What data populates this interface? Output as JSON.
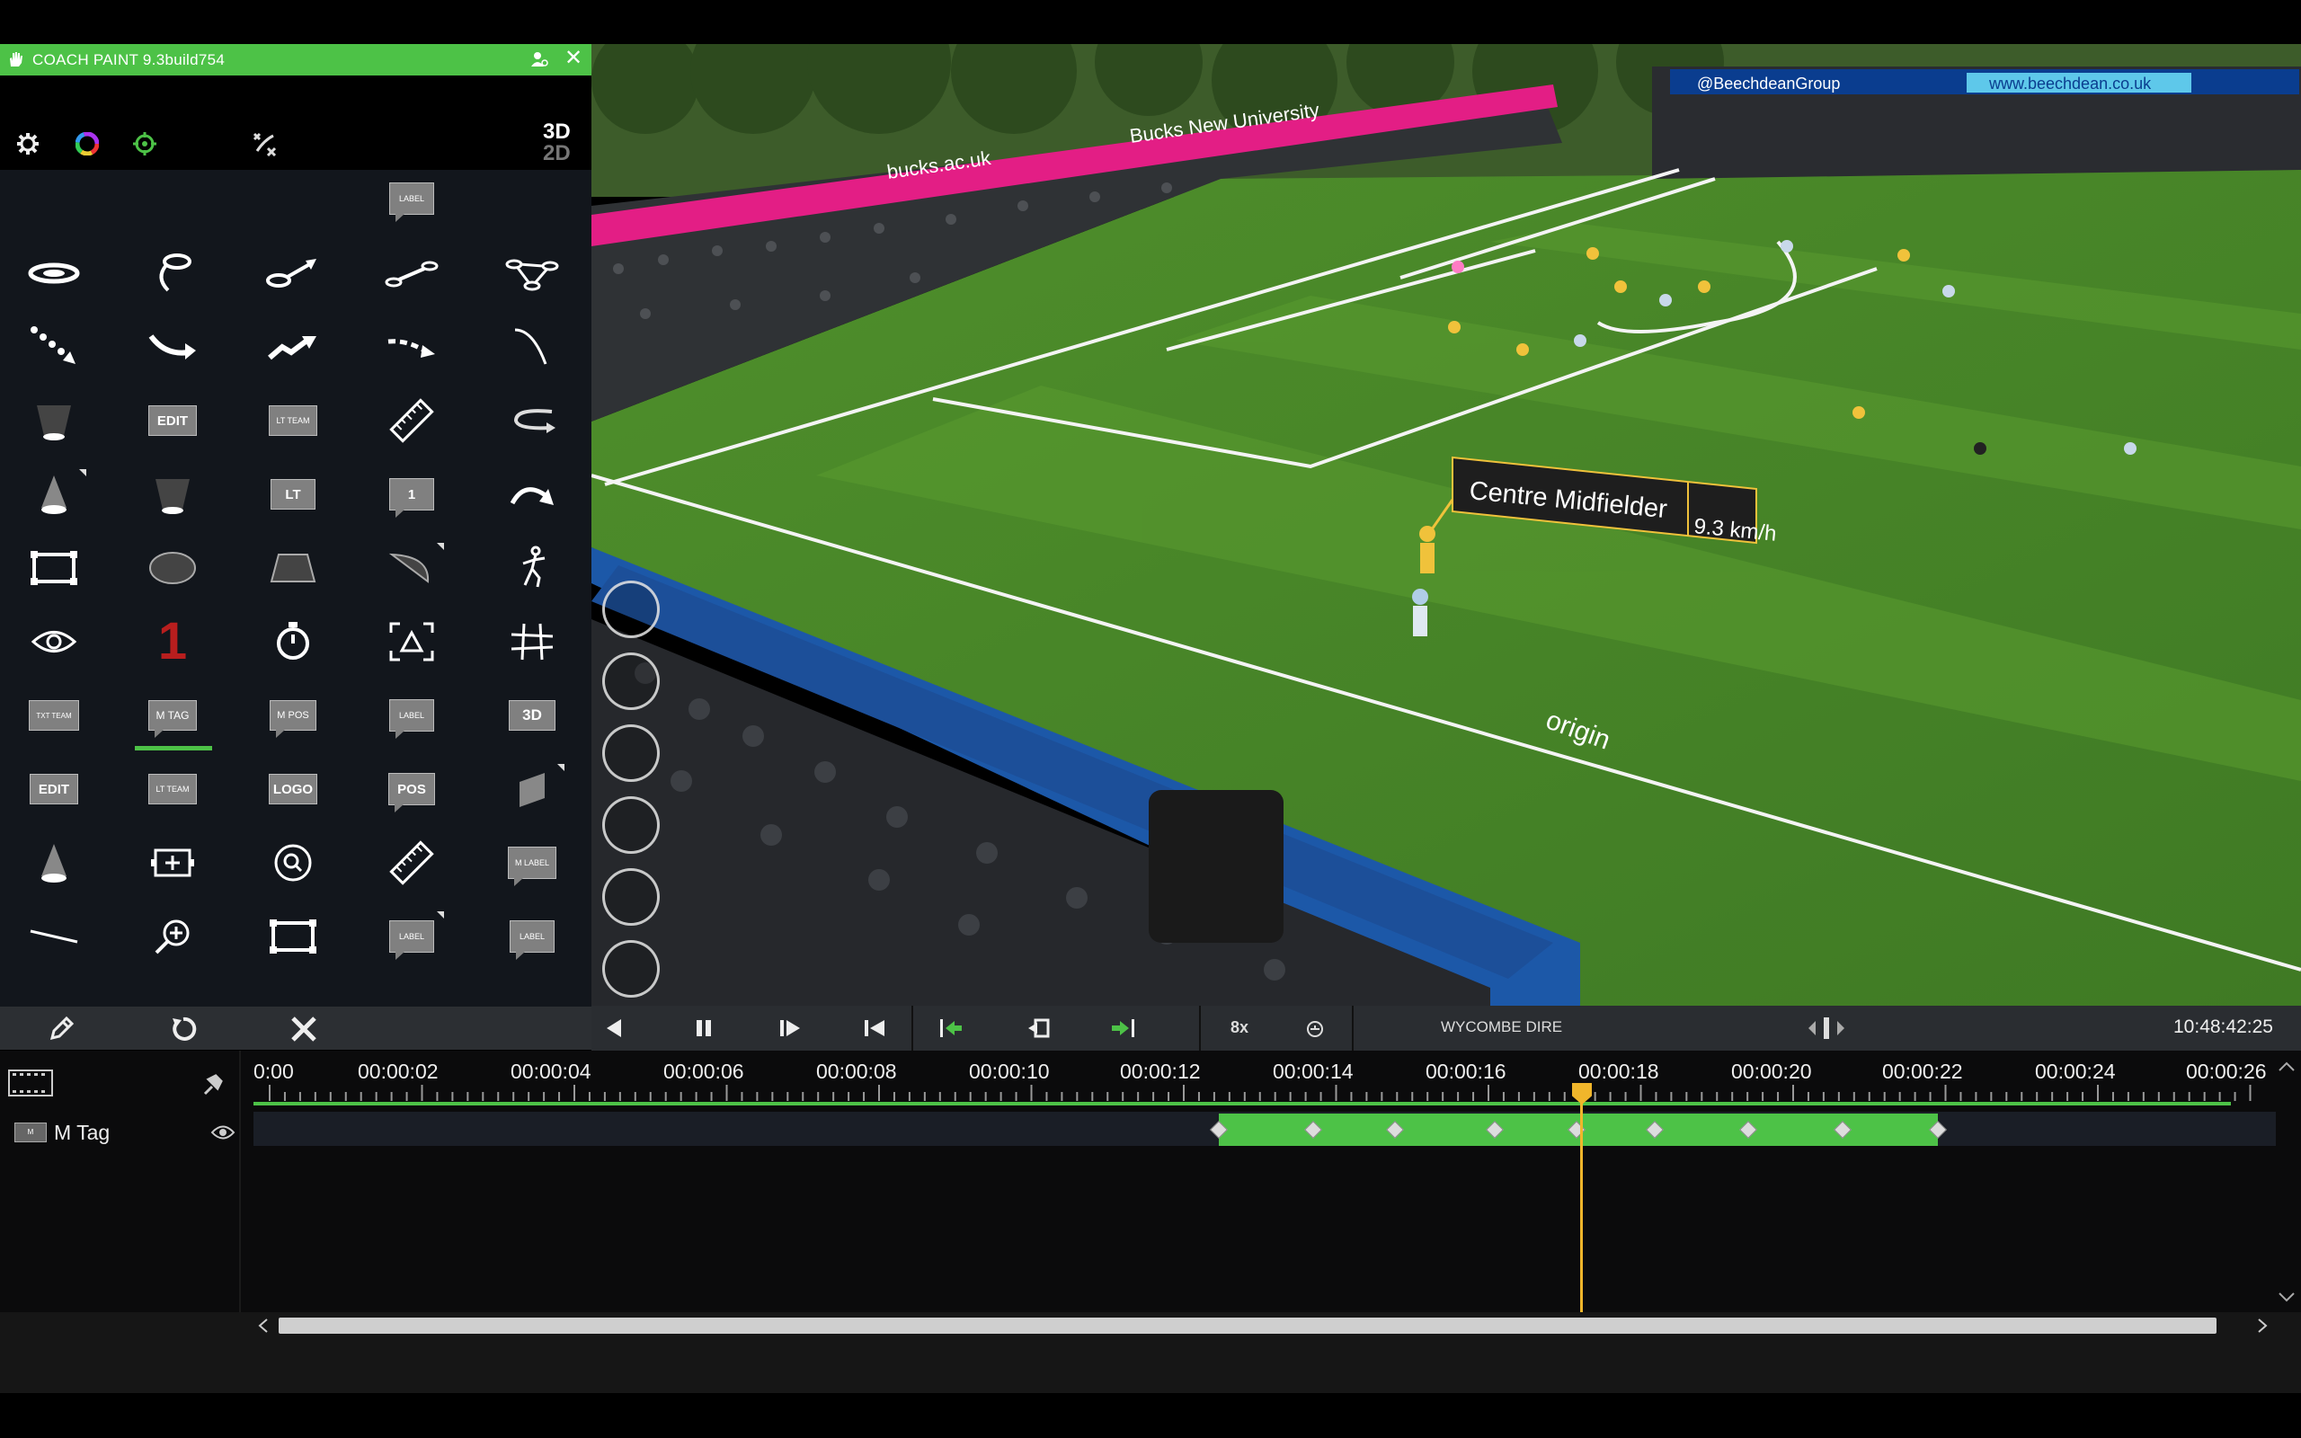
{
  "app": {
    "title": "COACH PAINT 9.3build754"
  },
  "panel": {
    "toggle_3d": "3D",
    "toggle_2d": "2D",
    "chips": {
      "label_top": "LABEL",
      "edit": "EDIT",
      "lt_team": "LT TEAM",
      "lt": "LT",
      "one_box": "1",
      "big_number": "1",
      "txt_team": "TXT TEAM",
      "m_tag": "M TAG",
      "m_pos": "M POS",
      "label_b": "LABEL",
      "three_d": "3D",
      "edit2": "EDIT",
      "lt_team2": "LT TEAM",
      "logo": "LOGO",
      "pos": "POS",
      "m_label": "M LABEL",
      "label_c": "LABEL",
      "label_d": "LABEL"
    }
  },
  "video": {
    "annotation": {
      "label": "Centre Midfielder",
      "speed": "9.3 km/h"
    },
    "ads": [
      "bucks.ac.uk",
      "Bucks New University",
      "@BeechdeanGroup",
      "www.beechdean.co.uk",
      "origin"
    ]
  },
  "transport": {
    "speed": "8x",
    "clip_name": "WYCOMBE DIRE",
    "timecode": "10:48:42:25"
  },
  "timeline": {
    "ruler": [
      "0:00",
      "00:00:02",
      "00:00:04",
      "00:00:06",
      "00:00:08",
      "00:00:10",
      "00:00:12",
      "00:00:14",
      "00:00:16",
      "00:00:18",
      "00:00:20",
      "00:00:22",
      "00:00:24",
      "00:00:26"
    ],
    "track": {
      "name": "M Tag"
    },
    "playhead_seconds": 17.6
  },
  "colors": {
    "accent": "#4dc247",
    "playhead": "#f0b62b",
    "panel": "#12161c"
  }
}
